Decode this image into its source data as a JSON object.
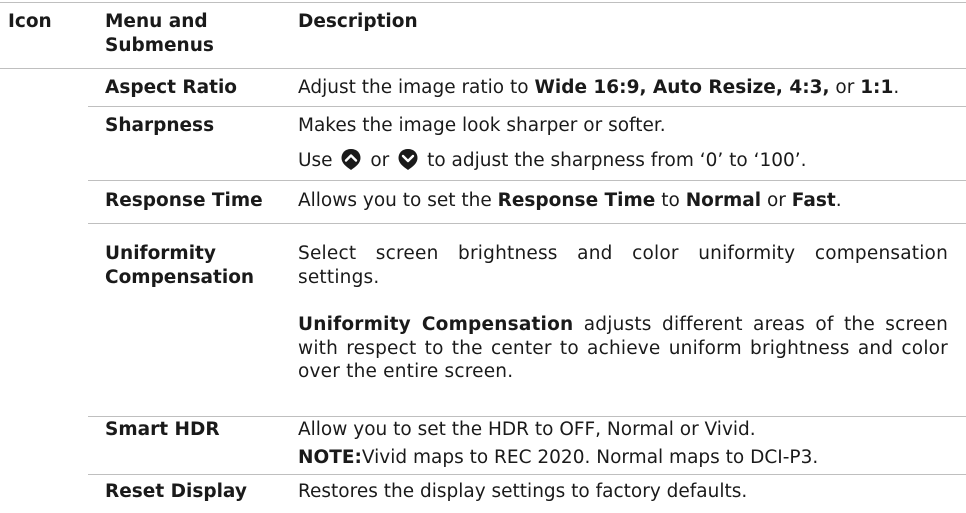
{
  "table": {
    "headers": {
      "icon": "Icon",
      "menu": "Menu and Submenus",
      "description": "Description"
    },
    "rows": {
      "aspect_ratio": {
        "menu": "Aspect Ratio",
        "desc": {
          "t1": "Adjust the image ratio to ",
          "b1": "Wide 16:9, Auto Resize, 4:3,",
          "t2": " or ",
          "b2": "1:1",
          "t3": "."
        }
      },
      "sharpness": {
        "menu": "Sharpness",
        "desc_line1": "Makes the image look sharper or softer.",
        "desc_line2": {
          "t1": "Use",
          "t2": "or",
          "t3": "to adjust the sharpness from ‘0’ to ‘100’."
        },
        "up_icon": "up-arrow-icon",
        "down_icon": "down-arrow-icon"
      },
      "response_time": {
        "menu": "Response Time",
        "desc": {
          "t1": "Allows you to set the ",
          "b1": "Response Time",
          "t2": " to ",
          "b2": "Normal",
          "t3": " or ",
          "b3": "Fast",
          "t4": "."
        }
      },
      "uniformity": {
        "menu_line1": "Uniformity",
        "menu_line2": "Compensation",
        "desc_para1": "Select screen brightness and color uniformity compensation settings.",
        "desc_para2": {
          "b1": "Uniformity Compensation",
          "t1": " adjusts different areas of the screen with respect to the center to achieve uniform brightness and color over the entire screen."
        }
      },
      "smart_hdr": {
        "menu": "Smart HDR",
        "desc_line1": "Allow you to set the HDR to OFF, Normal or Vivid.",
        "note": {
          "b1": "NOTE:",
          "t1": "Vivid maps to REC 2020.  Normal maps to DCI-P3."
        }
      },
      "reset_display": {
        "menu": "Reset Display",
        "desc": "Restores the display settings to factory defaults."
      }
    }
  },
  "colors": {
    "text": "#1a1a1a",
    "rule": "#bfbfbf"
  }
}
